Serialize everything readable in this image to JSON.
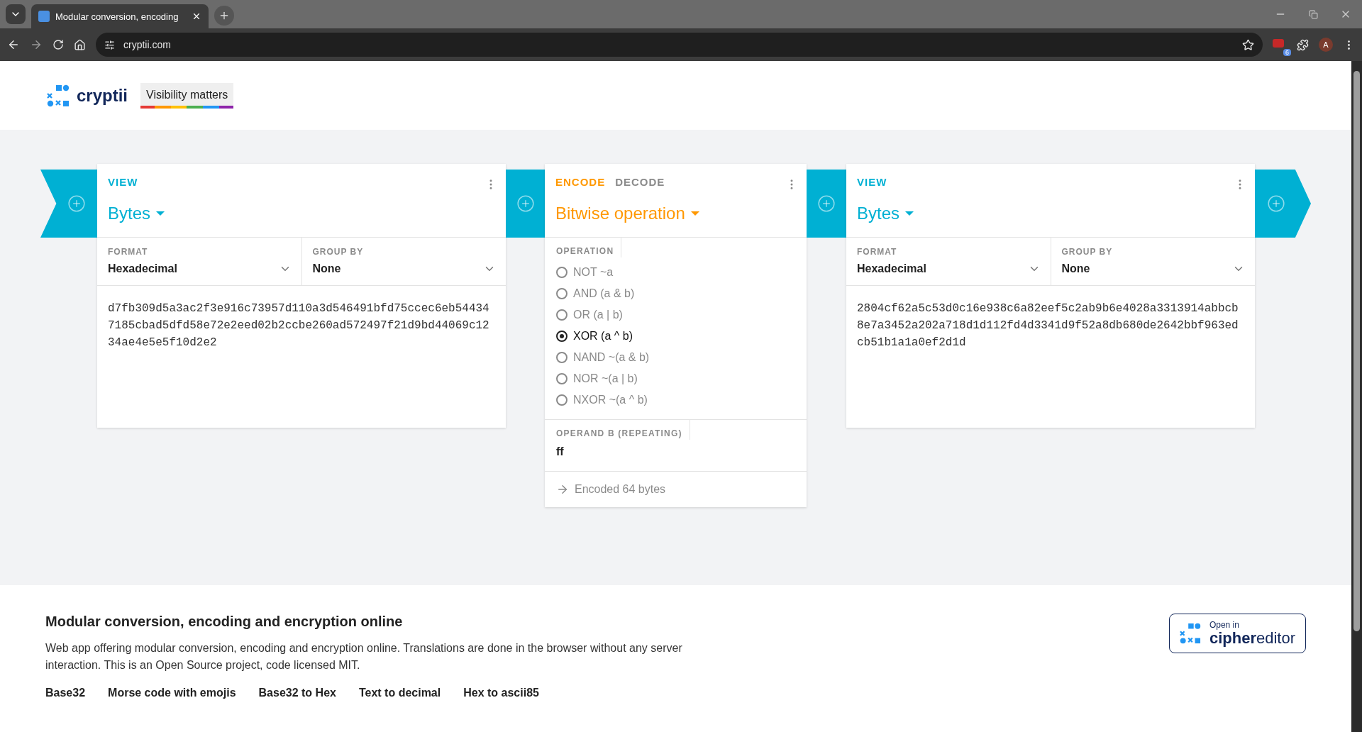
{
  "browser": {
    "tab_title": "Modular conversion, encoding",
    "url": "cryptii.com",
    "extension_badge": "6",
    "avatar": "A"
  },
  "header": {
    "logo_text": "cryptii",
    "tagline": "Visibility matters"
  },
  "pipeline": {
    "input_view": {
      "tab": "VIEW",
      "name": "Bytes",
      "fields": [
        {
          "label": "FORMAT",
          "value": "Hexadecimal"
        },
        {
          "label": "GROUP BY",
          "value": "None"
        }
      ],
      "content": "d7fb309d5a3ac2f3e916c73957d110a3d546491bfd75ccec6eb544347185cbad5dfd58e72e2eed02b2ccbe260ad572497f21d9bd44069c1234ae4e5e5f10d2e2"
    },
    "encoder": {
      "tabs": [
        {
          "label": "ENCODE",
          "selected": true
        },
        {
          "label": "DECODE",
          "selected": false
        }
      ],
      "name": "Bitwise operation",
      "operation_label": "OPERATION",
      "operations": [
        {
          "label": "NOT ~a",
          "selected": false
        },
        {
          "label": "AND (a & b)",
          "selected": false
        },
        {
          "label": "OR (a | b)",
          "selected": false
        },
        {
          "label": "XOR (a ^ b)",
          "selected": true
        },
        {
          "label": "NAND ~(a & b)",
          "selected": false
        },
        {
          "label": "NOR ~(a | b)",
          "selected": false
        },
        {
          "label": "NXOR ~(a ^ b)",
          "selected": false
        }
      ],
      "operand_label": "OPERAND B (REPEATING)",
      "operand_value": "ff",
      "status": "Encoded 64 bytes"
    },
    "output_view": {
      "tab": "VIEW",
      "name": "Bytes",
      "fields": [
        {
          "label": "FORMAT",
          "value": "Hexadecimal"
        },
        {
          "label": "GROUP BY",
          "value": "None"
        }
      ],
      "content": "2804cf62a5c53d0c16e938c6a82eef5c2ab9b6e4028a3313914abbcb8e7a3452a202a718d1d112fd4d3341d9f52a8db680de2642bbf963edcb51b1a1a0ef2d1d"
    }
  },
  "footer": {
    "title": "Modular conversion, encoding and encryption online",
    "description": "Web app offering modular conversion, encoding and encryption online. Translations are done in the browser without any server interaction. This is an Open Source project, code licensed MIT.",
    "links": [
      "Base32",
      "Morse code with emojis",
      "Base32 to Hex",
      "Text to decimal",
      "Hex to ascii85"
    ],
    "open_in": {
      "caption": "Open in",
      "brand": "**cipher**editor"
    }
  }
}
